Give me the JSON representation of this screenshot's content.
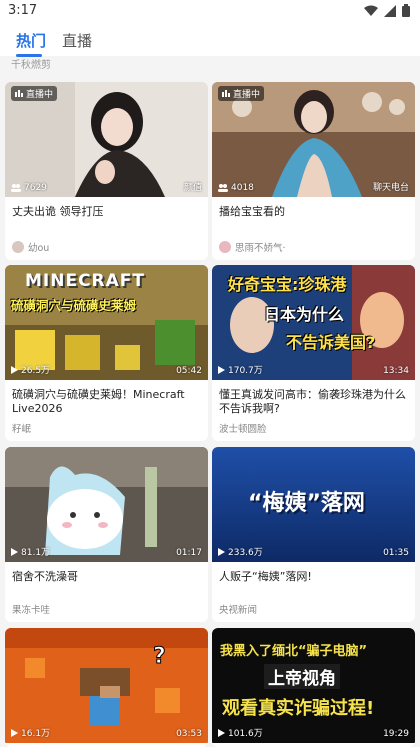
{
  "status": {
    "time": "3:17"
  },
  "tabs": [
    {
      "label": "热门"
    },
    {
      "label": "直播"
    }
  ],
  "prev_author": "千秋燃剪",
  "cards": [
    {
      "live_label": "直播中",
      "viewers": "7629",
      "corner": "颜值",
      "title": "丈夫出诡 领导打压",
      "author": "幼ou"
    },
    {
      "live_label": "直播中",
      "viewers": "4018",
      "corner": "聊天电台",
      "title": "播给宝宝看的",
      "author": "思雨不娇气·"
    },
    {
      "views": "26.5万",
      "duration": "05:42",
      "title": "硫磺洞穴与硫磺史莱姆！Minecraft Live2026",
      "author": "籽岷",
      "overlay_lines": [
        "MINECRAFT",
        "硫磺洞穴与硫磺史莱姆"
      ]
    },
    {
      "views": "170.7万",
      "duration": "13:34",
      "title": "懂王真诚发问高市：偷袭珍珠港为什么不告诉我啊?",
      "author": "波士顿圆脸",
      "overlay_lines": [
        "好奇宝宝:珍珠港",
        "日本为什么",
        "不告诉美国?"
      ]
    },
    {
      "views": "81.1万",
      "duration": "01:17",
      "title": "宿舍不洗澡哥",
      "author": "果冻卡哇"
    },
    {
      "views": "233.6万",
      "duration": "01:35",
      "title": "人贩子“梅姨”落网!",
      "author": "央视新闻",
      "overlay_lines": [
        "“梅姨”落网"
      ]
    },
    {
      "views": "16.1万",
      "duration": "03:53",
      "title": "",
      "author": ""
    },
    {
      "views": "101.6万",
      "duration": "19:29",
      "title": "",
      "author": "",
      "overlay_lines": [
        "我黑入了缅北“骗子电脑”",
        "上帝视角",
        "观看真实诈骗过程!"
      ]
    }
  ],
  "colors": {
    "accent": "#2a73e8"
  }
}
